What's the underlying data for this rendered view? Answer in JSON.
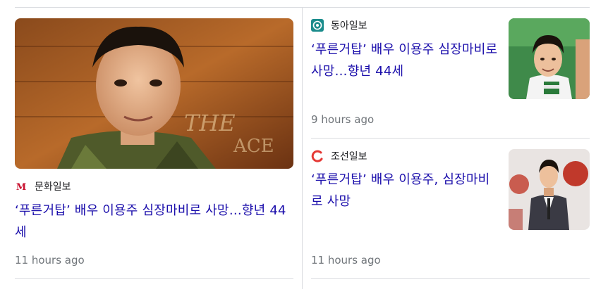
{
  "articles": [
    {
      "source": "문화일보",
      "logo_letter": "M",
      "headline": "‘푸른거탑’ 배우 이용주 심장마비로 사망…향년 44세",
      "time": "11 hours ago"
    },
    {
      "source": "동아일보",
      "headline": "‘푸른거탑’ 배우 이용주 심장마비로 사망…향년 44세",
      "time": "9 hours ago"
    },
    {
      "source": "조선일보",
      "headline": "‘푸른거탑’ 배우 이용주, 심장마비로 사망",
      "time": "11 hours ago"
    }
  ],
  "colors": {
    "headline": "#1a0dab",
    "time": "#70757a",
    "divider": "#dadce0",
    "munhwa_logo": "#c8102e",
    "donga_logo": "#1b8c8c",
    "chosun_logo": "#e53935"
  },
  "icons": [
    "munhwa-logo-icon",
    "donga-logo-icon",
    "chosun-logo-icon"
  ]
}
